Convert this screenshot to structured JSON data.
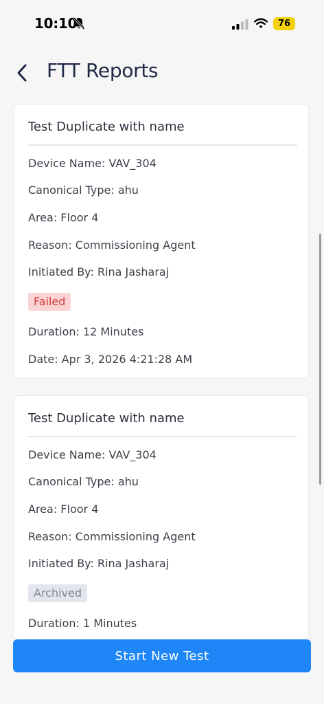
{
  "status_bar": {
    "time": "10:10",
    "battery": "76"
  },
  "header": {
    "title": "FTT Reports"
  },
  "reports": [
    {
      "title": "Test Duplicate with name",
      "device_name": "Device Name: VAV_304",
      "canonical_type": "Canonical Type: ahu",
      "area": "Area: Floor 4",
      "reason": "Reason: Commissioning Agent",
      "initiated_by": "Initiated By: Rina Jasharaj",
      "status": "Failed",
      "duration": "Duration: 12 Minutes",
      "date": "Date: Apr 3, 2026 4:21:28 AM"
    },
    {
      "title": "Test Duplicate with name",
      "device_name": "Device Name: VAV_304",
      "canonical_type": "Canonical Type: ahu",
      "area": "Area: Floor 4",
      "reason": "Reason: Commissioning Agent",
      "initiated_by": "Initiated By: Rina Jasharaj",
      "status": "Archived",
      "duration": "Duration: 1 Minutes"
    }
  ],
  "footer": {
    "start_label": "Start New Test"
  },
  "colors": {
    "primary": "#1e86f7",
    "failed_bg": "#fad4d4",
    "failed_text": "#d33a3a",
    "archived_bg": "#e3e6ec",
    "archived_text": "#7b8496",
    "battery": "#f4d20b"
  }
}
